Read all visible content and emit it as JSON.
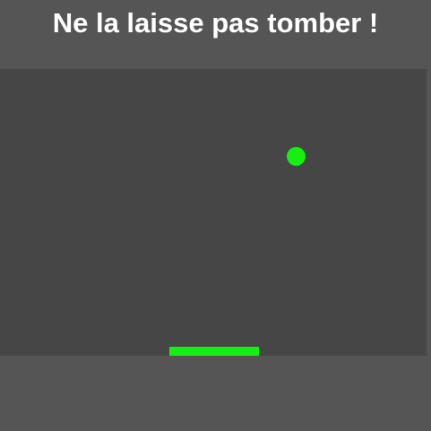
{
  "game": {
    "title": "Ne la laisse pas tomber !",
    "colors": {
      "background": "#555555",
      "arena": "#464646",
      "ball": "#15f012",
      "paddle": "#15f012",
      "title_text": "#ffffff"
    }
  }
}
